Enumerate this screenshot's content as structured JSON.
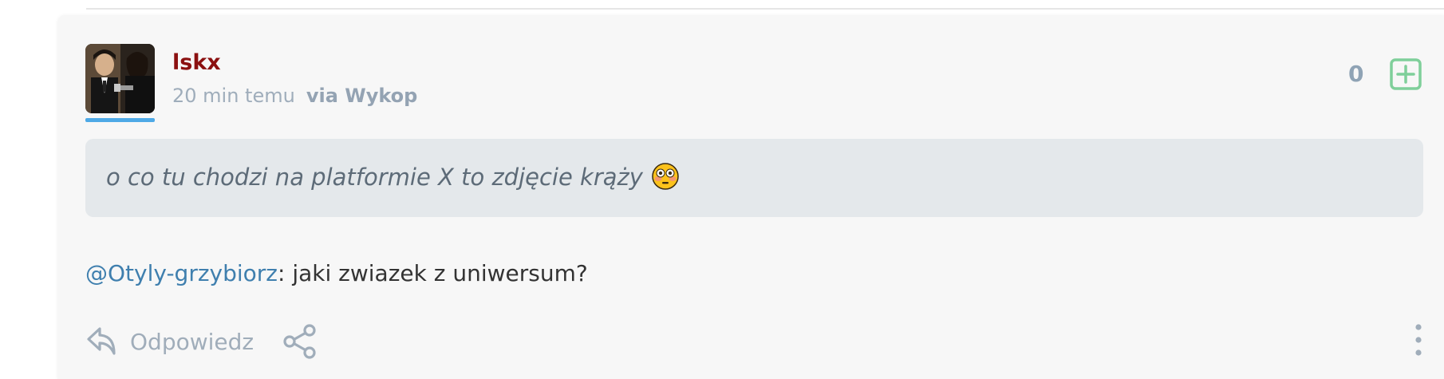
{
  "entry": {
    "author": "lskx",
    "time_ago": "20 min temu",
    "via": "via Wykop",
    "vote_count": "0",
    "quote_text": "o co tu chodzi na platformie X to zdjęcie krąży",
    "mention": "@Otyly-grzybiorz",
    "comment_text": ": jaki zwiazek z uniwersum?",
    "reply_label": "Odpowiedz",
    "icons": {
      "vote": "plus-square-icon",
      "reply": "reply-arrow-icon",
      "share": "share-icon",
      "more": "kebab-menu-icon",
      "emoji": "flushed-face-emoji"
    }
  },
  "colors": {
    "author": "#8b1010",
    "mention": "#3f7fae",
    "plus": "#7fcf9a",
    "avatar_underline": "#4ea9e6",
    "quote_bg": "#e4e8eb"
  }
}
